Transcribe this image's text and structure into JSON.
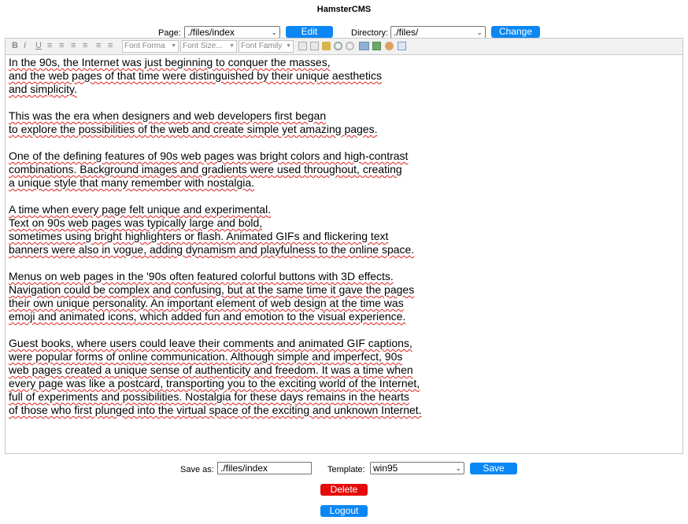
{
  "app": {
    "title": "HamsterCMS"
  },
  "top_bar": {
    "page_label": "Page:",
    "page_value": "./files/index",
    "edit_label": "Edit",
    "directory_label": "Directory:",
    "directory_value": "./files/",
    "change_label": "Change"
  },
  "toolbar": {
    "bold": "B",
    "italic": "I",
    "underline": "U",
    "font_format": "Font Forma",
    "font_size": "Font Size...",
    "font_family": "Font Family"
  },
  "editor": {
    "lines": [
      "In the 90s, the Internet was just beginning to conquer the masses,",
      "and the web pages of that time were distinguished by their unique aesthetics",
      "and simplicity.",
      "",
      "This was the era when designers and web developers first began",
      "to explore the possibilities of the web and create simple yet amazing pages.",
      "",
      "One of the defining features of 90s web pages was bright colors and high-contrast",
      "combinations. Background images and gradients were used throughout, creating",
      "a unique style that many remember with nostalgia.",
      "",
      "A time when every page felt unique and experimental.",
      "Text on 90s web pages was typically large and bold,",
      "sometimes using bright highlighters or flash. Animated GIFs and flickering text",
      "banners were also in vogue, adding dynamism and playfulness to the online space.",
      "",
      "Menus on web pages in the '90s often featured colorful buttons with 3D effects.",
      "Navigation could be complex and confusing, but at the same time it gave the pages",
      "their own unique personality. An important element of web design at the time was",
      "emoji and animated icons, which added fun and emotion to the visual experience.",
      "",
      "Guest books, where users could leave their comments and animated GIF captions,",
      "were popular forms of online communication. Although simple and imperfect, 90s",
      "web pages created a unique sense of authenticity and freedom. It was a time when",
      "every page was like a postcard, transporting you to the exciting world of the Internet,",
      "full of experiments and possibilities. Nostalgia for these days remains in the hearts",
      "of those who first plunged into the virtual space of the exciting and unknown Internet."
    ]
  },
  "bottom_bar": {
    "save_as_label": "Save as:",
    "save_as_value": "./files/index",
    "template_label": "Template:",
    "template_value": "win95",
    "save_label": "Save",
    "delete_label": "Delete",
    "logout_label": "Logout"
  },
  "colors": {
    "primary_button": "#0b87f4",
    "danger_button": "#e40b0b",
    "spellcheck": "#d22222"
  }
}
